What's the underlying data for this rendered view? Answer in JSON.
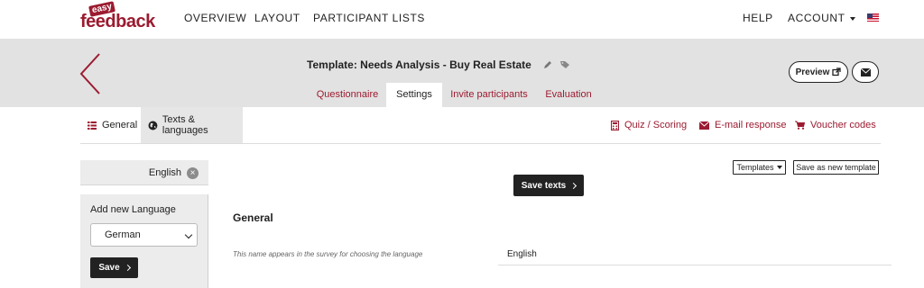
{
  "topnav": {
    "logo_small": "easy",
    "logo_main": "feedback",
    "overview": "OVERVIEW",
    "layout": "LAYOUT",
    "participant_lists": "PARTICIPANT LISTS",
    "help": "HELP",
    "account": "ACCOUNT",
    "flag_icon": "us-flag-icon"
  },
  "header": {
    "title": "Template: Needs Analysis - Buy Real Estate",
    "tabs": [
      {
        "label": "Questionnaire",
        "active": false
      },
      {
        "label": "Settings",
        "active": true
      },
      {
        "label": "Invite participants",
        "active": false
      },
      {
        "label": "Evaluation",
        "active": false
      }
    ],
    "preview_label": "Preview"
  },
  "subnav": {
    "left": [
      {
        "label": "General",
        "icon": "list-icon",
        "active": false
      },
      {
        "label": "Texts & languages",
        "icon": "globe-icon",
        "active": true
      }
    ],
    "right": [
      {
        "label": "Quiz / Scoring",
        "icon": "calculator-icon"
      },
      {
        "label": "E-mail response",
        "icon": "envelope-icon"
      },
      {
        "label": "Voucher codes",
        "icon": "cart-icon"
      }
    ]
  },
  "sidebar": {
    "current_language": "English",
    "remove_symbol": "×",
    "add_label": "Add new Language",
    "select_value": "German",
    "save_label": "Save"
  },
  "main": {
    "templates_label": "Templates",
    "save_template_label": "Save as new template",
    "save_texts_label": "Save texts",
    "section_title": "General",
    "hint": "This name appears in the survey for choosing the language",
    "field_value": "English"
  },
  "colors": {
    "brand": "#9b1b30",
    "band": "#e2e2e2",
    "dark_button": "#222222"
  }
}
